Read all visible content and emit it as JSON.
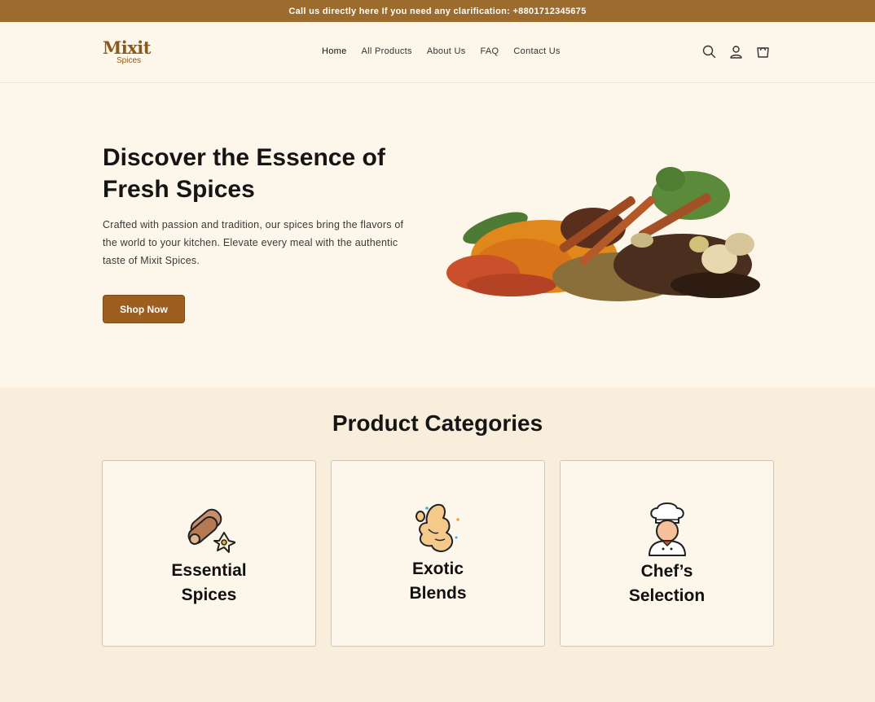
{
  "announcement": "Call us directly here If you need any clarification: +8801712345675",
  "brand": {
    "name": "Mixit",
    "tagline": "Spices",
    "color": "#8a5a1c"
  },
  "nav": {
    "items": [
      {
        "label": "Home"
      },
      {
        "label": "All Products"
      },
      {
        "label": "About Us"
      },
      {
        "label": "FAQ"
      },
      {
        "label": "Contact Us"
      }
    ]
  },
  "header_icons": [
    "search-icon",
    "account-icon",
    "cart-icon"
  ],
  "hero": {
    "title": "Discover the Essence of Fresh Spices",
    "description": "Crafted with passion and tradition, our spices bring the flavors of the world to your kitchen. Elevate every meal with the authentic taste of Mixit Spices.",
    "cta": "Shop Now"
  },
  "categories": {
    "heading": "Product Categories",
    "items": [
      {
        "label_1": "Essential",
        "label_2": "Spices",
        "icon": "cinnamon-icon"
      },
      {
        "label_1": "Exotic",
        "label_2": "Blends",
        "icon": "ginger-icon"
      },
      {
        "label_1": "Chef’s",
        "label_2": "Selection",
        "icon": "chef-icon"
      }
    ]
  },
  "colors": {
    "accent": "#9c5f20",
    "announce_bg": "#9c6b2e",
    "page_bg": "#fdf6ea",
    "section_bg": "#f9eedb"
  }
}
